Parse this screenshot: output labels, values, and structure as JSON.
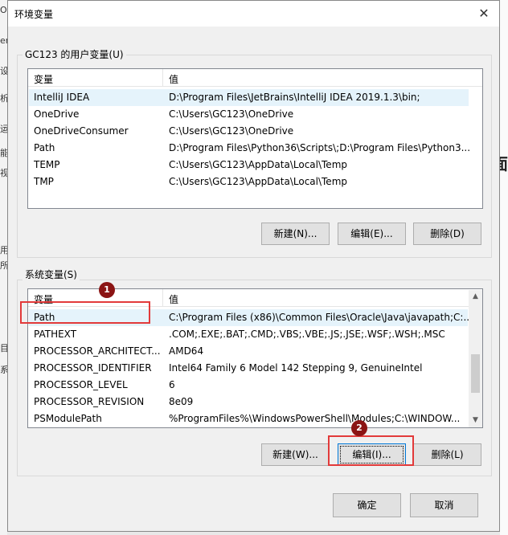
{
  "background": {
    "left_fragments": [
      "O",
      "er",
      "设",
      "析",
      "运",
      "能",
      "视",
      "用",
      "所",
      "目",
      "系"
    ],
    "right_fragment": "面"
  },
  "dialog": {
    "title": "环境变量",
    "close_glyph": "✕"
  },
  "user_vars": {
    "group_label": "GC123 的用户变量(U)",
    "columns": [
      "变量",
      "值"
    ],
    "rows": [
      {
        "name": "IntelliJ IDEA",
        "value": "D:\\Program Files\\JetBrains\\IntelliJ IDEA 2019.1.3\\bin;"
      },
      {
        "name": "OneDrive",
        "value": "C:\\Users\\GC123\\OneDrive"
      },
      {
        "name": "OneDriveConsumer",
        "value": "C:\\Users\\GC123\\OneDrive"
      },
      {
        "name": "Path",
        "value": "D:\\Program Files\\Python36\\Scripts\\;D:\\Program Files\\Python3..."
      },
      {
        "name": "TEMP",
        "value": "C:\\Users\\GC123\\AppData\\Local\\Temp"
      },
      {
        "name": "TMP",
        "value": "C:\\Users\\GC123\\AppData\\Local\\Temp"
      }
    ],
    "buttons": {
      "new": "新建(N)...",
      "edit": "编辑(E)...",
      "delete": "删除(D)"
    }
  },
  "system_vars": {
    "group_label": "系统变量(S)",
    "columns": [
      "变量",
      "值"
    ],
    "rows": [
      {
        "name": "Path",
        "value": "C:\\Program Files (x86)\\Common Files\\Oracle\\Java\\javapath;C:..."
      },
      {
        "name": "PATHEXT",
        "value": ".COM;.EXE;.BAT;.CMD;.VBS;.VBE;.JS;.JSE;.WSF;.WSH;.MSC"
      },
      {
        "name": "PROCESSOR_ARCHITECT...",
        "value": "AMD64"
      },
      {
        "name": "PROCESSOR_IDENTIFIER",
        "value": "Intel64 Family 6 Model 142 Stepping 9, GenuineIntel"
      },
      {
        "name": "PROCESSOR_LEVEL",
        "value": "6"
      },
      {
        "name": "PROCESSOR_REVISION",
        "value": "8e09"
      },
      {
        "name": "PSModulePath",
        "value": "%ProgramFiles%\\WindowsPowerShell\\Modules;C:\\WINDOW..."
      }
    ],
    "buttons": {
      "new": "新建(W)...",
      "edit": "编辑(I)...",
      "delete": "删除(L)"
    }
  },
  "annotations": {
    "step1": "1",
    "step2": "2",
    "highlight_color": "#e23a3a",
    "badge_color": "#8b1414"
  },
  "footer": {
    "ok": "确定",
    "cancel": "取消"
  }
}
